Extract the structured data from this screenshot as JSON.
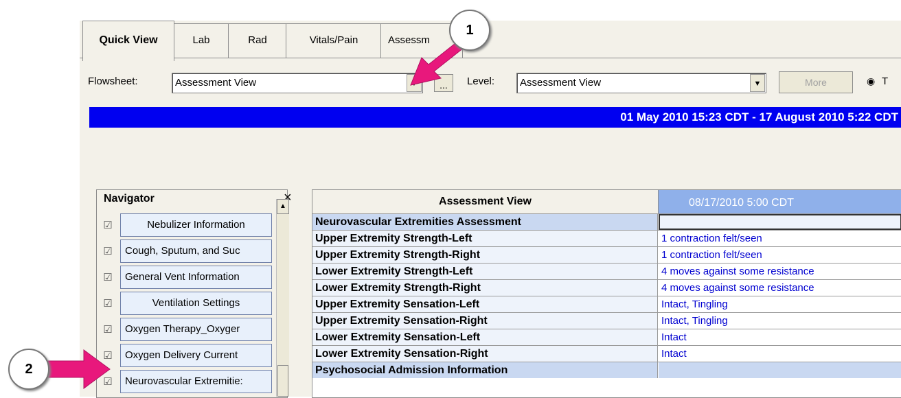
{
  "tabs": [
    {
      "label": "Quick View",
      "active": true
    },
    {
      "label": "Lab"
    },
    {
      "label": "Rad"
    },
    {
      "label": "Vitals/Pain"
    },
    {
      "label": "Assessm"
    }
  ],
  "toolbar": {
    "flowsheet_label": "Flowsheet:",
    "flowsheet_value": "Assessment View",
    "ellipsis_label": "...",
    "level_label": "Level:",
    "level_value": "Assessment View",
    "more_label": "More",
    "radio_label": "T"
  },
  "date_range": "01 May 2010 15:23 CDT - 17 August 2010 5:22 CDT",
  "navigator": {
    "title": "Navigator",
    "close": "×",
    "items": [
      {
        "label": "Nebulizer Information"
      },
      {
        "label": "Cough, Sputum, and Suc"
      },
      {
        "label": "General Vent Information"
      },
      {
        "label": "Ventilation Settings"
      },
      {
        "label": "Oxygen Therapy_Oxyger"
      },
      {
        "label": "Oxygen Delivery Current"
      },
      {
        "label": "Neurovascular Extremitie:"
      }
    ]
  },
  "grid": {
    "header_left": "Assessment View",
    "header_right": "08/17/2010 5:00 CDT",
    "rows": [
      {
        "label": "Neurovascular Extremities Assessment",
        "value": "",
        "section": true
      },
      {
        "label": "Upper Extremity Strength-Left",
        "value": "1 contraction felt/seen"
      },
      {
        "label": "Upper Extremity Strength-Right",
        "value": "1 contraction felt/seen"
      },
      {
        "label": "Lower Extremity Strength-Left",
        "value": "4 moves against some resistance"
      },
      {
        "label": "Lower Extremity Strength-Right",
        "value": "4 moves against some resistance"
      },
      {
        "label": "Upper Extremity Sensation-Left",
        "value": "Intact, Tingling"
      },
      {
        "label": "Upper Extremity Sensation-Right",
        "value": "Intact, Tingling"
      },
      {
        "label": "Lower Extremity Sensation-Left",
        "value": "Intact"
      },
      {
        "label": "Lower Extremity Sensation-Right",
        "value": "Intact"
      },
      {
        "label": "Psychosocial Admission Information",
        "value": "",
        "section": true
      }
    ]
  },
  "callouts": {
    "one": "1",
    "two": "2"
  },
  "colors": {
    "date_bar": "#0000f0",
    "column_header": "#8fb0ea",
    "arrow": "#e8187c"
  }
}
